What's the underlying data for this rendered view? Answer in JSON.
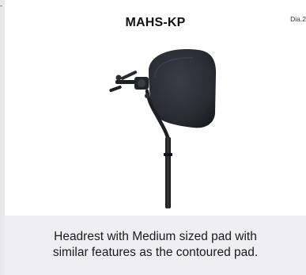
{
  "header": {
    "title": "MAHS-KP",
    "figure_label": "Dia.2"
  },
  "image": {
    "subject_icon": "headrest-with-mounting-hardware-icon",
    "colors": {
      "pad": "#2b2d35",
      "hardware": "#1e1f24"
    }
  },
  "caption": {
    "line1": "Headrest with Medium sized pad with",
    "line2": "similar features as the contoured pad."
  }
}
